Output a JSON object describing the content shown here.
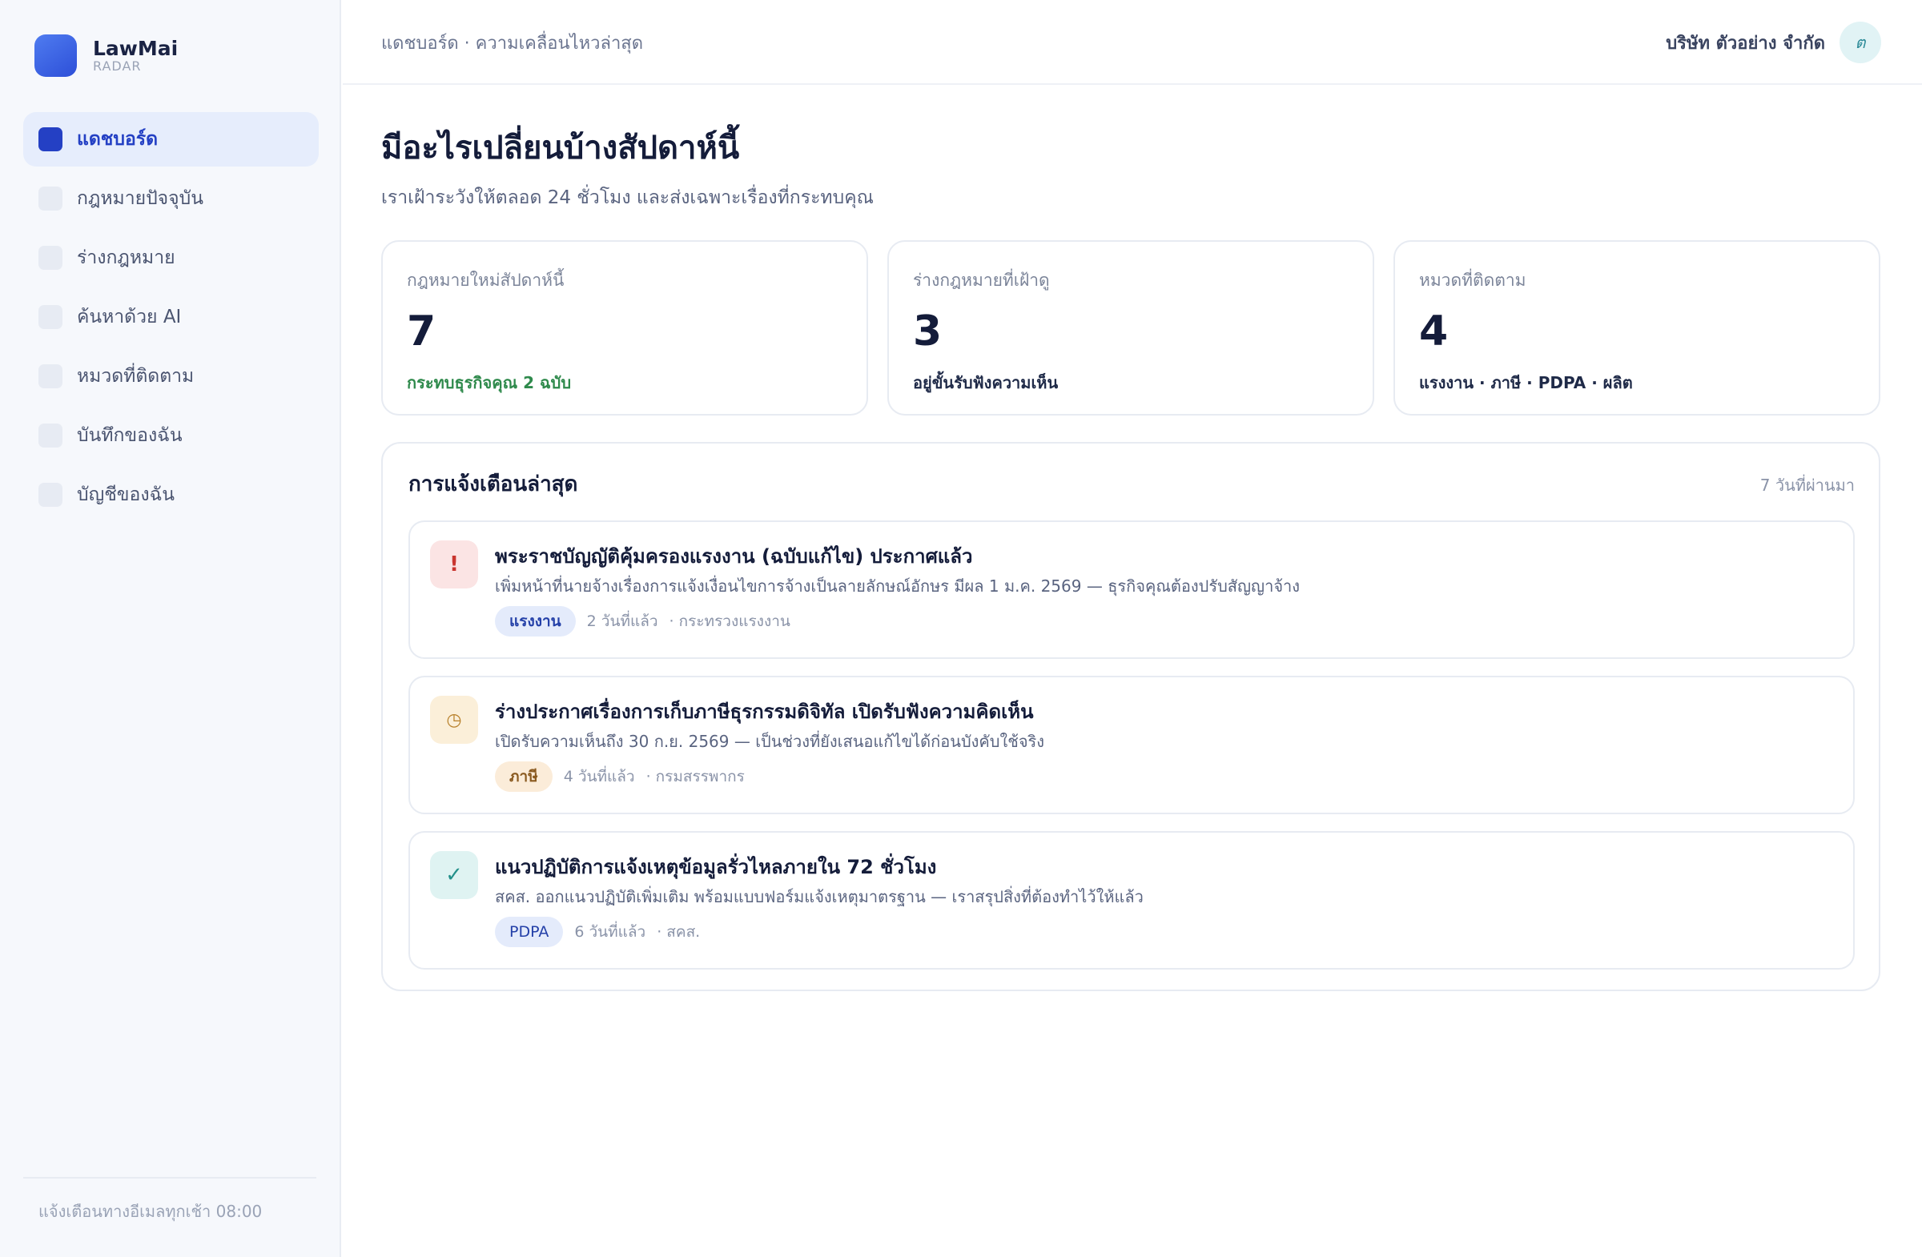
{
  "brand": {
    "name": "LawMai",
    "sub": "RADAR"
  },
  "sidebar": {
    "items": [
      {
        "label": "แดชบอร์ด",
        "active": true
      },
      {
        "label": "กฎหมายปัจจุบัน",
        "active": false
      },
      {
        "label": "ร่างกฎหมาย",
        "active": false
      },
      {
        "label": "ค้นหาด้วย AI",
        "active": false
      },
      {
        "label": "หมวดที่ติดตาม",
        "active": false
      },
      {
        "label": "บันทึกของฉัน",
        "active": false
      },
      {
        "label": "บัญชีของฉัน",
        "active": false
      }
    ],
    "footer": "แจ้งเตือนทางอีเมลทุกเช้า 08:00"
  },
  "topbar": {
    "breadcrumb": "แดชบอร์ด · ความเคลื่อนไหวล่าสุด",
    "company": "บริษัท ตัวอย่าง จำกัด",
    "avatar_initial": "ต"
  },
  "main": {
    "title": "มีอะไรเปลี่ยนบ้างสัปดาห์นี้",
    "subtitle": "เราเฝ้าระวังให้ตลอด 24 ชั่วโมง และส่งเฉพาะเรื่องที่กระทบคุณ"
  },
  "stats": [
    {
      "label": "กฎหมายใหม่สัปดาห์นี้",
      "value": "7",
      "note": "กระทบธุรกิจคุณ 2 ฉบับ",
      "note_color": "#2f8a4c"
    },
    {
      "label": "ร่างกฎหมายที่เฝ้าดู",
      "value": "3",
      "note": "อยู่ขั้นรับฟังความเห็น"
    },
    {
      "label": "หมวดที่ติดตาม",
      "value": "4",
      "note": "แรงงาน · ภาษี · PDPA · ผลิต"
    }
  ],
  "alerts": {
    "title": "การแจ้งเตือนล่าสุด",
    "range": "7 วันที่ผ่านมา",
    "items": [
      {
        "icon": "exclamation-icon",
        "icon_glyph": "!",
        "title": "พระราชบัญญัติคุ้มครองแรงงาน (ฉบับแก้ไข) ประกาศแล้ว",
        "desc": "เพิ่มหน้าที่นายจ้างเรื่องการแจ้งเงื่อนไขการจ้างเป็นลายลักษณ์อักษร มีผล 1 ม.ค. 2569 — ธุรกิจคุณต้องปรับสัญญาจ้าง",
        "tag": "แรงงาน",
        "time": "2 วันที่แล้ว",
        "source": "· กระทรวงแรงงาน"
      },
      {
        "icon": "clock-icon",
        "icon_glyph": "◷",
        "title": "ร่างประกาศเรื่องการเก็บภาษีธุรกรรมดิจิทัล เปิดรับฟังความคิดเห็น",
        "desc": "เปิดรับความเห็นถึง 30 ก.ย. 2569 — เป็นช่วงที่ยังเสนอแก้ไขได้ก่อนบังคับใช้จริง",
        "tag": "ภาษี",
        "time": "4 วันที่แล้ว",
        "source": "· กรมสรรพากร"
      },
      {
        "icon": "checkmark-icon",
        "icon_glyph": "✓",
        "title": "แนวปฏิบัติการแจ้งเหตุข้อมูลรั่วไหลภายใน 72 ชั่วโมง",
        "desc": "สคส. ออกแนวปฏิบัติเพิ่มเติม พร้อมแบบฟอร์มแจ้งเหตุมาตรฐาน — เราสรุปสิ่งที่ต้องทำไว้ให้แล้ว",
        "tag": "PDPA",
        "time": "6 วันที่แล้ว",
        "source": "· สคส."
      }
    ]
  },
  "colors": {
    "accent": "#2440c4",
    "sidebar_bg": "#f6f8fc",
    "positive": "#2f8a4c"
  }
}
